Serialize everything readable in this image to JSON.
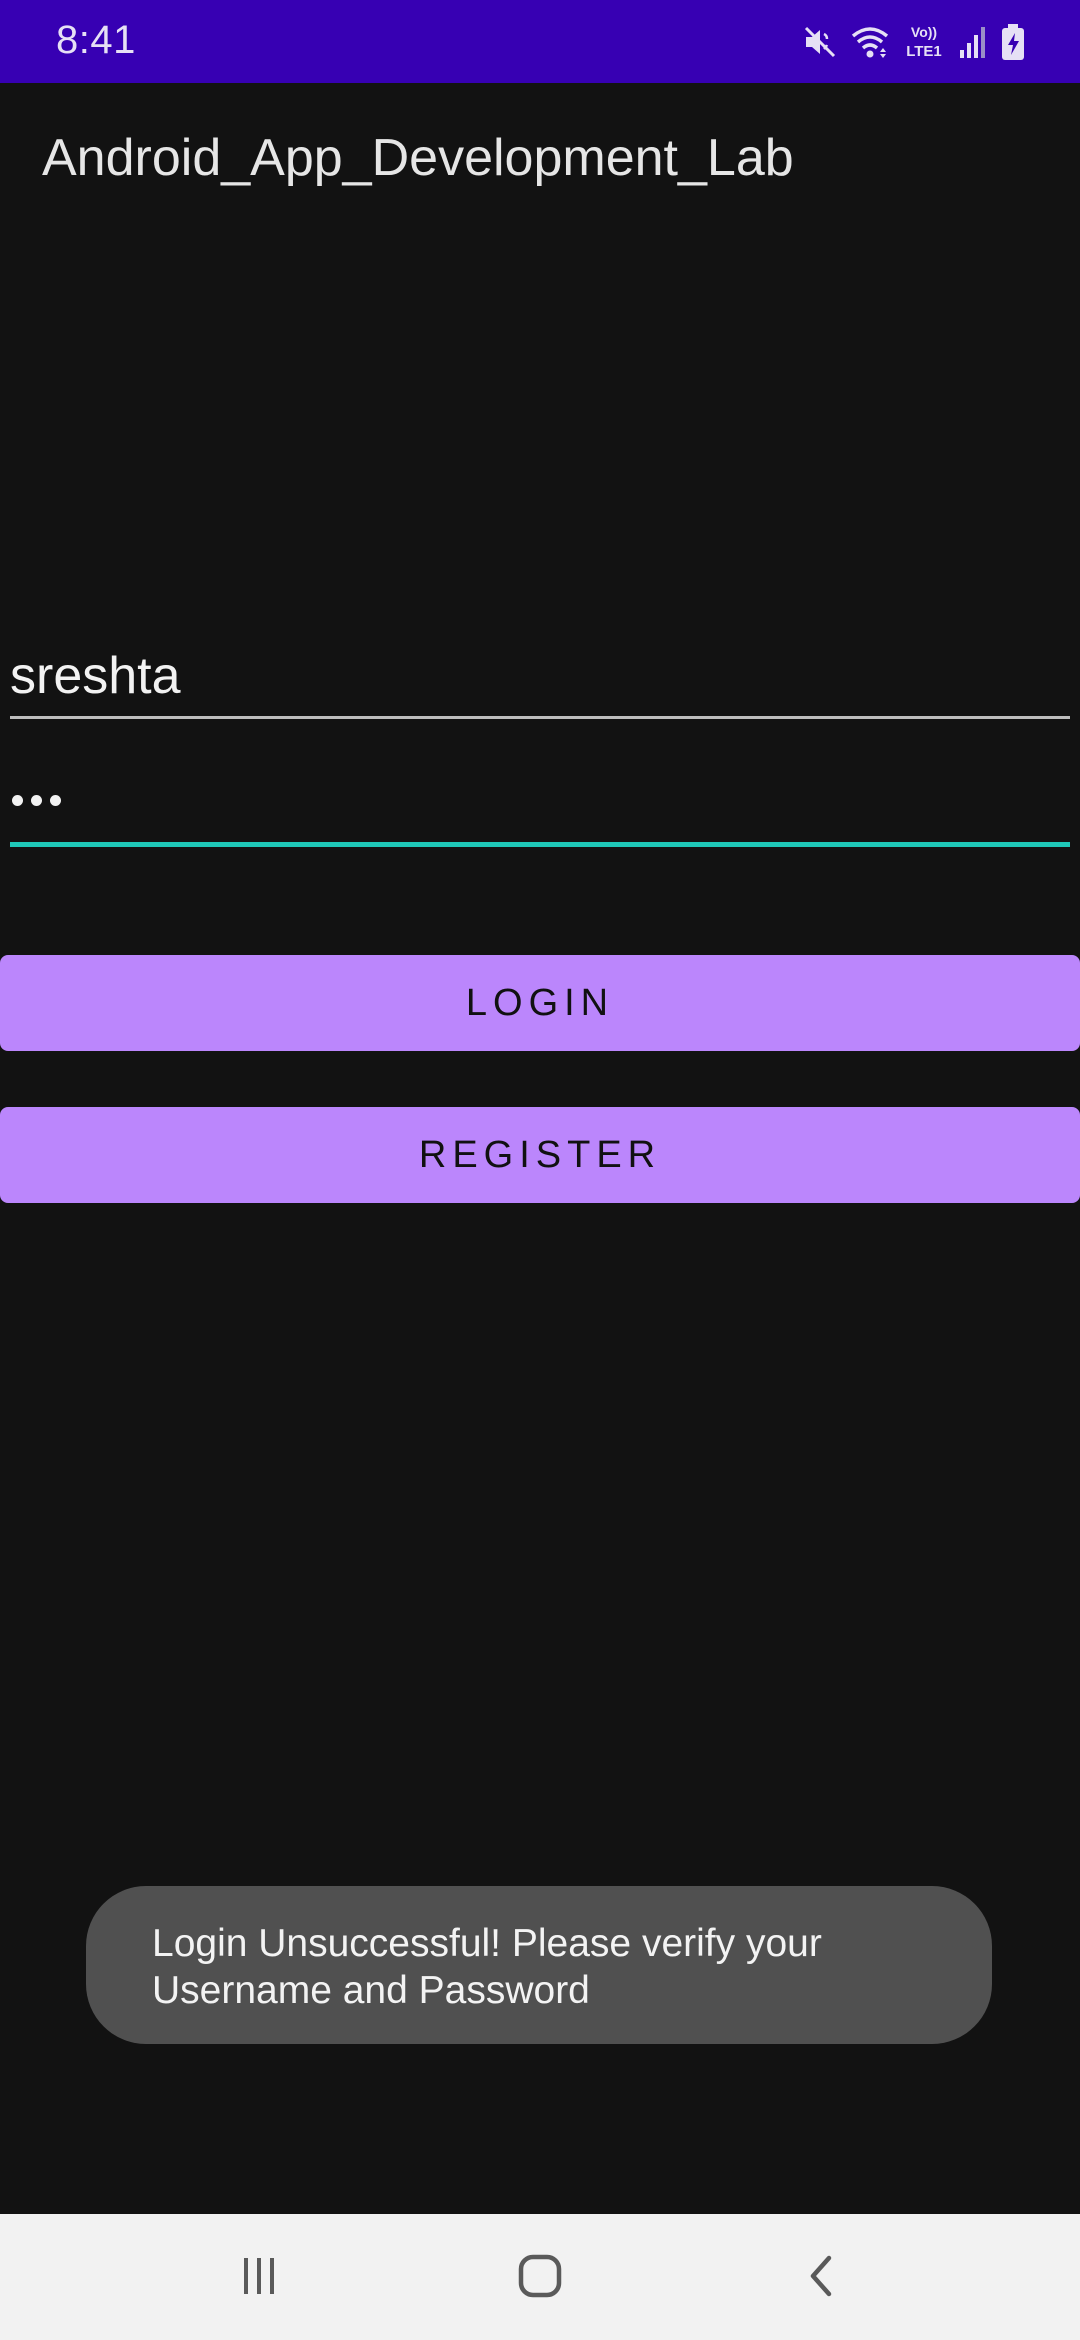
{
  "status_bar": {
    "time": "8:41",
    "network_label": "Vo)) LTE1",
    "icons": [
      "mute-icon",
      "wifi-icon",
      "volte-lte-icon",
      "signal-icon",
      "battery-charging-icon"
    ]
  },
  "app": {
    "title": "Android_App_Development_Lab"
  },
  "form": {
    "username_value": "sreshta",
    "password_length": 3,
    "login_label": "LOGIN",
    "register_label": "REGISTER"
  },
  "toast": {
    "line1": "Login Unsuccessful! Please verify your",
    "line2": "Username and Password"
  },
  "nav_bar": {
    "icons": [
      "recents-icon",
      "home-icon",
      "back-icon"
    ]
  },
  "colors": {
    "status_bar": "#3700B3",
    "background": "#121212",
    "button": "#BB86FC",
    "focused_underline": "#1FC8B8",
    "toast": "#505050"
  }
}
